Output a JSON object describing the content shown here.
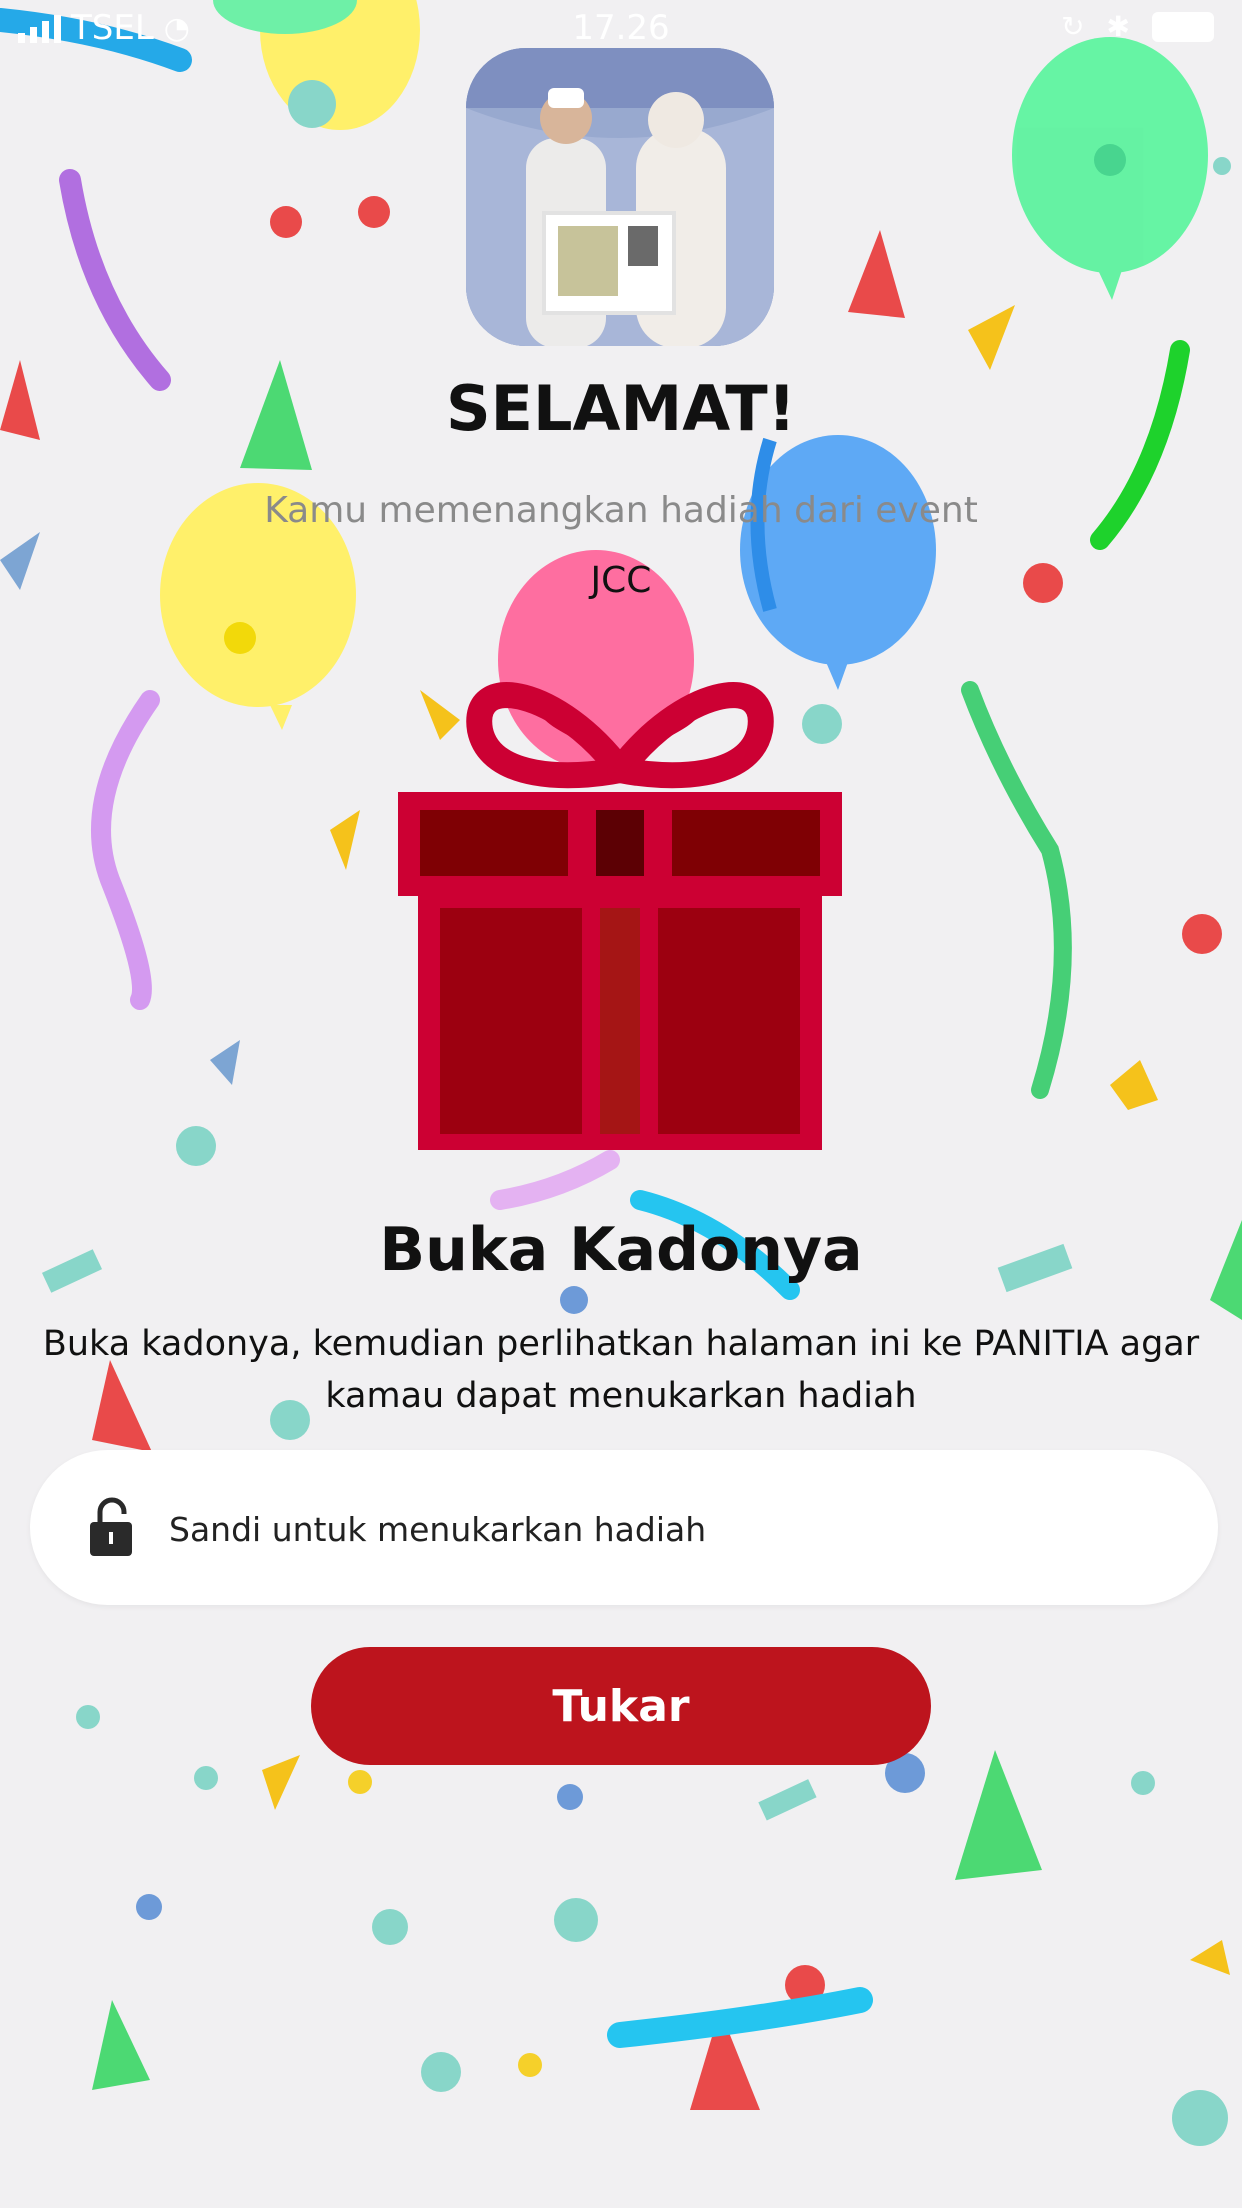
{
  "status_bar": {
    "carrier": "TSEL",
    "time": "17.26"
  },
  "header": {
    "title": "SELAMAT!",
    "subtitle": "Kamu memenangkan hadiah dari event",
    "event_name": "JCC"
  },
  "gift_section": {
    "title": "Buka Kadonya",
    "description": "Buka kadonya, kemudian perlihatkan halaman ini ke PANITIA agar kamau dapat menukarkan hadiah"
  },
  "password_field": {
    "placeholder": "Sandi untuk menukarkan hadiah",
    "value": ""
  },
  "redeem_button": {
    "label": "Tukar"
  },
  "colors": {
    "primary": "#bd141d",
    "gift_red": "#9c0010",
    "gift_outline": "#cc0033",
    "background": "#f1f0f2"
  }
}
